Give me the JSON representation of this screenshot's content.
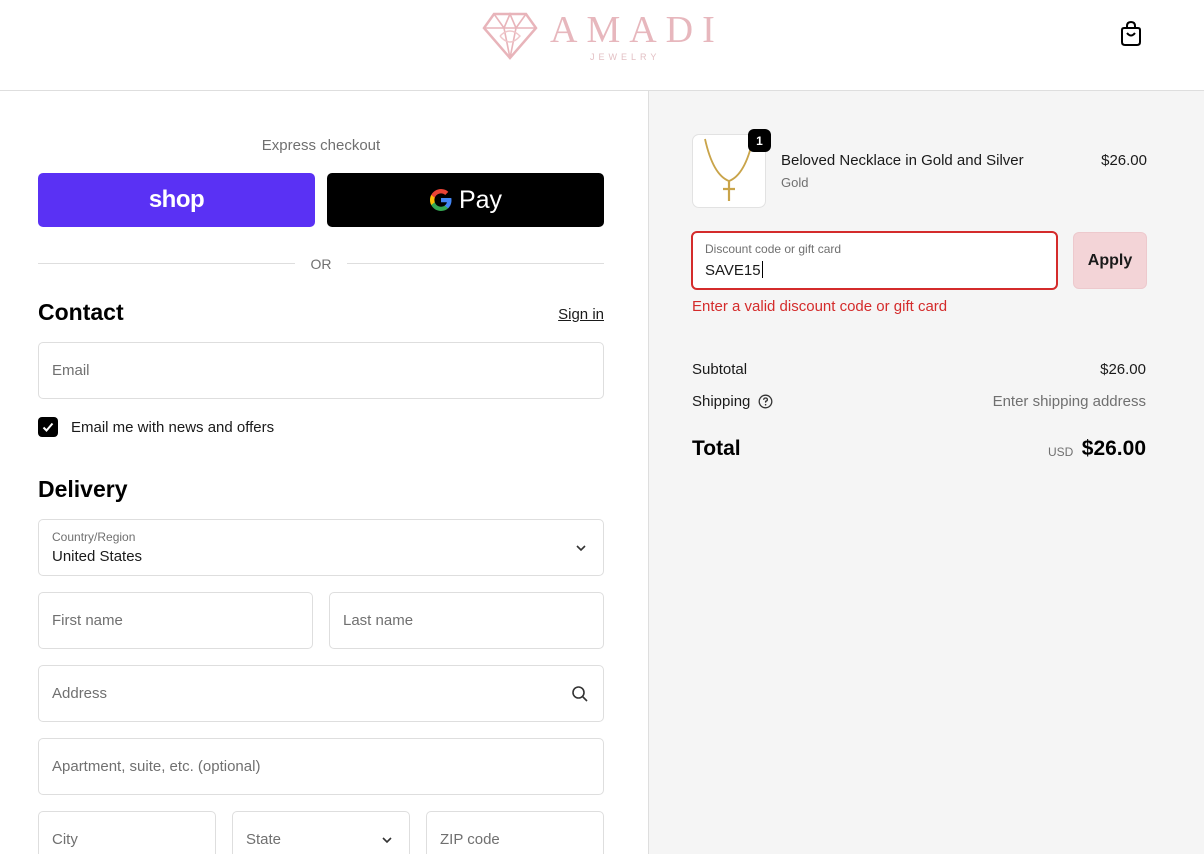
{
  "brand": {
    "name": "AMADI",
    "tagline": "JEWELRY"
  },
  "header": {
    "cart_icon": "shopping-bag-icon"
  },
  "express": {
    "title": "Express checkout",
    "shop_pay_label": "shop",
    "google_pay_label": "Pay",
    "separator": "OR"
  },
  "contact": {
    "heading": "Contact",
    "sign_in": "Sign in",
    "email_placeholder": "Email",
    "newsletter_label": "Email me with news and offers",
    "newsletter_checked": true
  },
  "delivery": {
    "heading": "Delivery",
    "country_label": "Country/Region",
    "country_value": "United States",
    "first_name_placeholder": "First name",
    "last_name_placeholder": "Last name",
    "address_placeholder": "Address",
    "apartment_placeholder": "Apartment, suite, etc. (optional)",
    "city_placeholder": "City",
    "state_placeholder": "State",
    "zip_placeholder": "ZIP code"
  },
  "order": {
    "item": {
      "name": "Beloved Necklace in Gold and Silver",
      "variant": "Gold",
      "price": "$26.00",
      "quantity": "1"
    },
    "discount": {
      "label": "Discount code or gift card",
      "value": "SAVE15",
      "apply_label": "Apply",
      "error": "Enter a valid discount code or gift card"
    },
    "subtotal_label": "Subtotal",
    "subtotal_value": "$26.00",
    "shipping_label": "Shipping",
    "shipping_value": "Enter shipping address",
    "total_label": "Total",
    "currency": "USD",
    "total_value": "$26.00"
  },
  "colors": {
    "shop_pay": "#5a31f4",
    "google_pay": "#000000",
    "error": "#d42b2b",
    "apply_button": "#f3d4d7",
    "summary_background": "#f5f5f5"
  }
}
